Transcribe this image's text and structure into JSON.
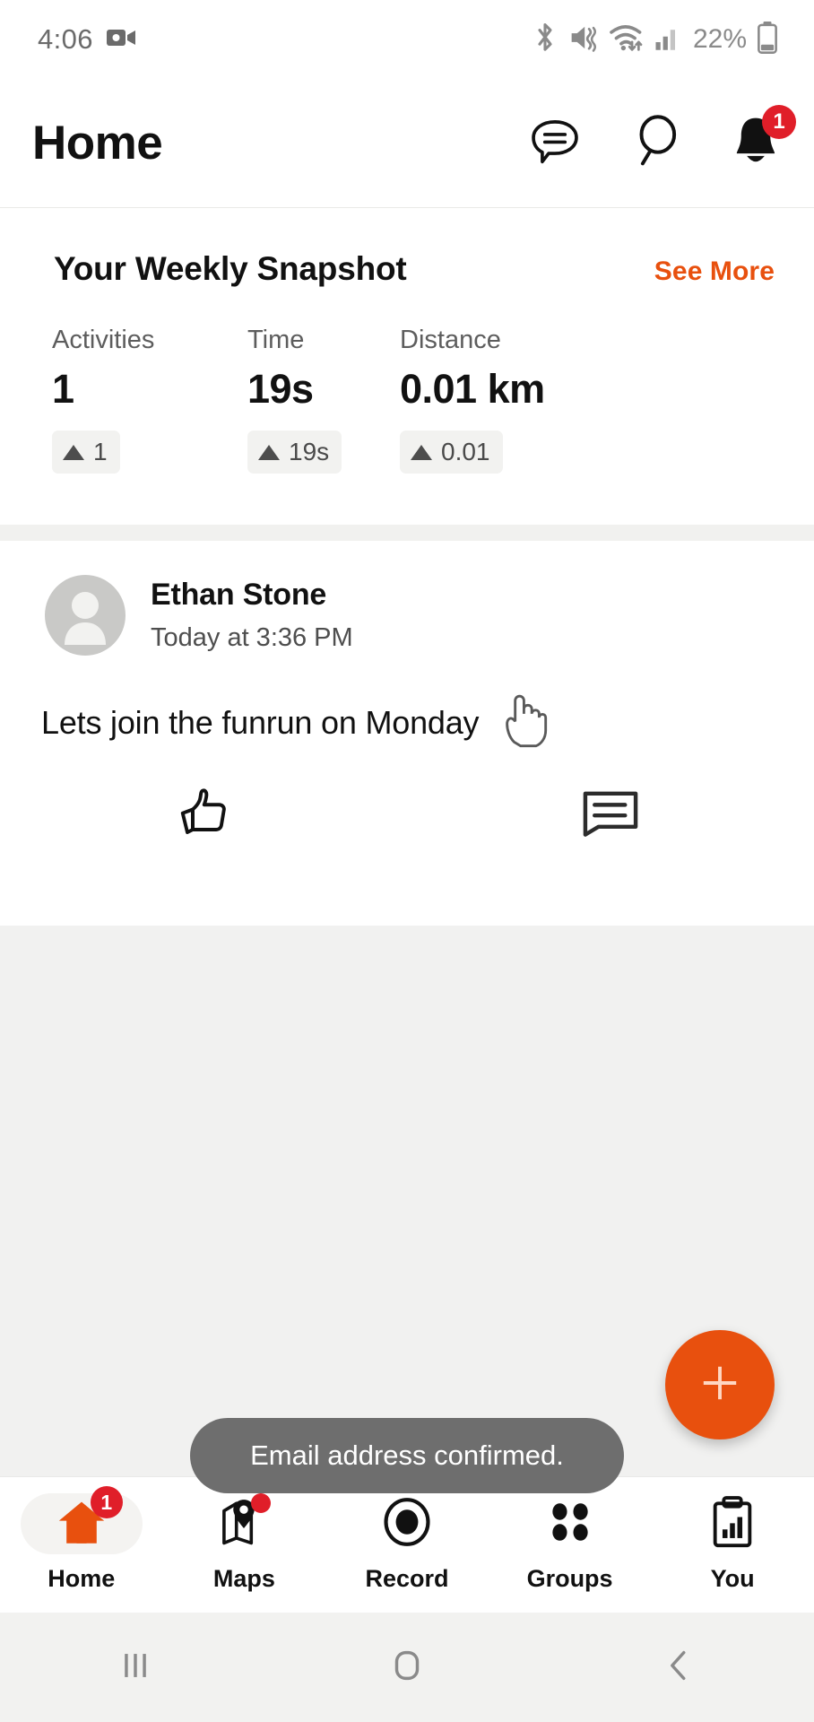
{
  "statusbar": {
    "time": "4:06",
    "battery_percent": "22%",
    "icons": [
      "video-camera-icon",
      "bluetooth-icon",
      "mute-vibrate-icon",
      "wifi-icon",
      "cellular-signal-icon",
      "battery-icon"
    ]
  },
  "header": {
    "title": "Home",
    "chat_icon": "chat-bubble-icon",
    "search_icon": "search-icon",
    "bell_icon": "bell-icon",
    "bell_badge": "1"
  },
  "snapshot": {
    "title": "Your Weekly Snapshot",
    "see_more": "See More",
    "stats": [
      {
        "label": "Activities",
        "value": "1",
        "delta": "1",
        "trend": "up"
      },
      {
        "label": "Time",
        "value": "19s",
        "delta": "19s",
        "trend": "up"
      },
      {
        "label": "Distance",
        "value": "0.01 km",
        "delta": "0.01",
        "trend": "up"
      }
    ]
  },
  "post": {
    "author": "Ethan Stone",
    "timestamp": "Today at 3:36 PM",
    "body": "Lets join the funrun on Monday",
    "like_icon": "thumbs-up-icon",
    "comment_icon": "comment-icon"
  },
  "fab": {
    "label": "+",
    "icon": "plus-icon"
  },
  "toast": {
    "message": "Email address confirmed."
  },
  "bottom_nav": {
    "items": [
      {
        "label": "Home",
        "icon": "home-icon",
        "active": true,
        "badge": "1"
      },
      {
        "label": "Maps",
        "icon": "map-pin-icon",
        "active": false,
        "dot": true
      },
      {
        "label": "Record",
        "icon": "record-circle-icon",
        "active": false
      },
      {
        "label": "Groups",
        "icon": "groups-dots-icon",
        "active": false
      },
      {
        "label": "You",
        "icon": "clipboard-chart-icon",
        "active": false
      }
    ]
  },
  "system_nav": {
    "recents_icon": "recents-icon",
    "home_icon": "home-square-icon",
    "back_icon": "back-chevron-icon"
  },
  "colors": {
    "accent_orange": "#E8500E",
    "badge_red": "#E01E29",
    "toast_gray": "#6E6E6E",
    "page_gray": "#F1F1F0"
  }
}
